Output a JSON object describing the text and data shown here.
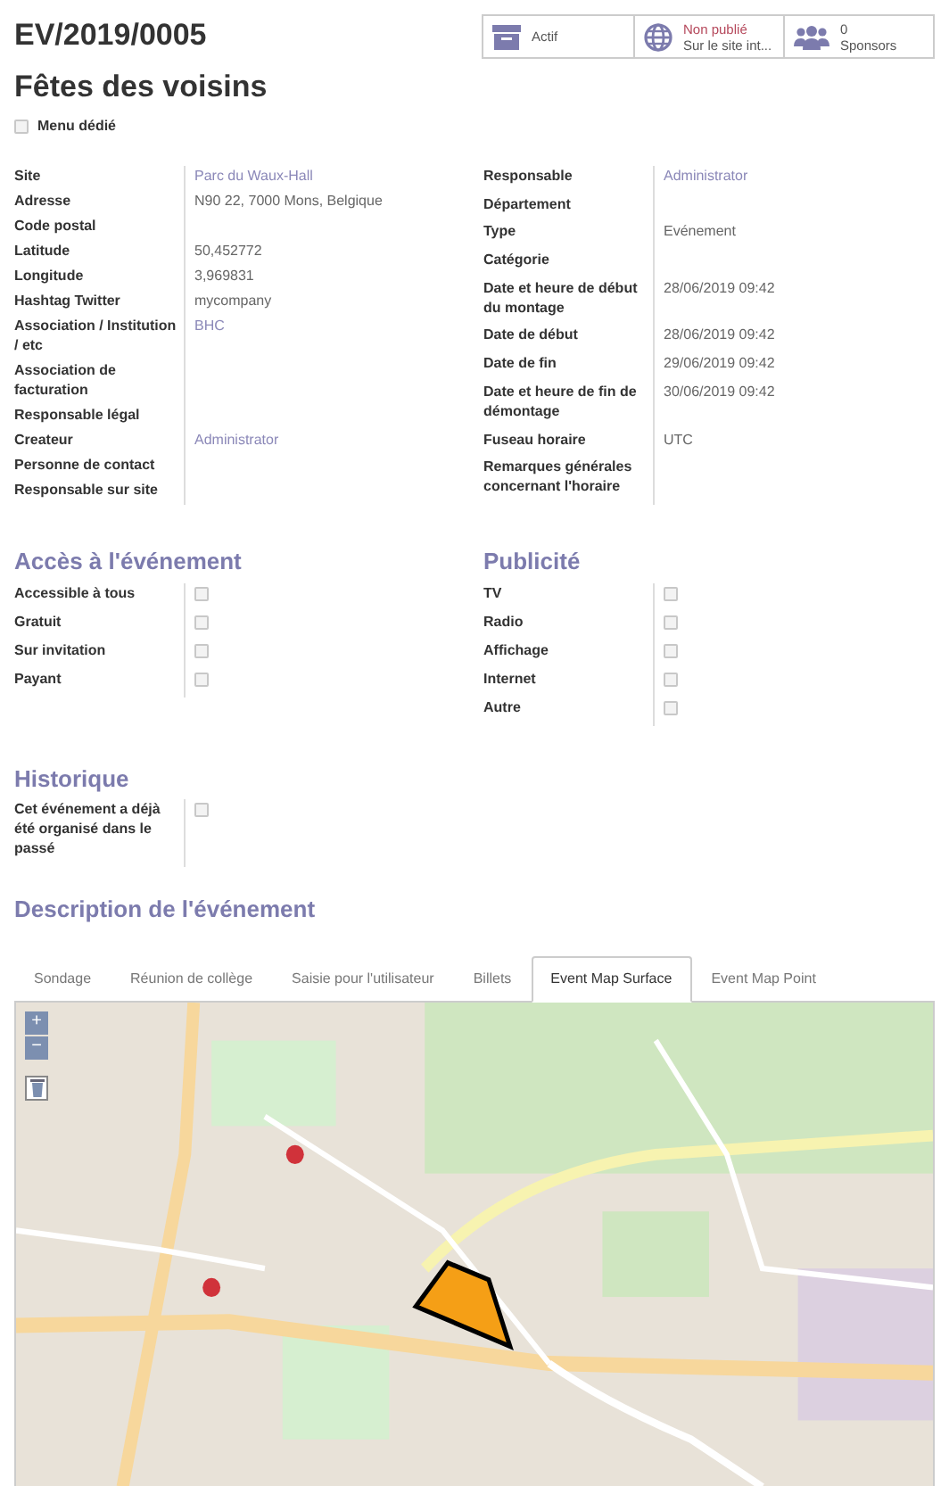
{
  "record": {
    "reference": "EV/2019/0005",
    "name": "Fêtes des voisins",
    "dedicated_menu": {
      "label": "Menu dédié",
      "checked": false
    }
  },
  "smart_buttons": [
    {
      "kind": "archive",
      "lines": [
        "Actif"
      ]
    },
    {
      "kind": "website",
      "lines": [
        "Non publié",
        "Sur le site int..."
      ]
    },
    {
      "kind": "sponsors",
      "lines": [
        "0",
        "Sponsors"
      ]
    }
  ],
  "fields_left": [
    {
      "label": "Site",
      "value": "Parc du Waux-Hall",
      "kind": "link"
    },
    {
      "label": "Adresse",
      "value": "N90 22, 7000 Mons, Belgique",
      "kind": "text"
    },
    {
      "label": "Code postal"
    },
    {
      "label": "Latitude",
      "value": "50,452772",
      "kind": "text"
    },
    {
      "label": "Longitude",
      "value": "3,969831",
      "kind": "text"
    },
    {
      "label": "Hashtag Twitter",
      "value": "mycompany",
      "kind": "text"
    },
    {
      "label": "Association / Institution / etc",
      "value": "BHC",
      "kind": "link"
    },
    {
      "label": "Association de facturation"
    },
    {
      "label": "Responsable légal"
    },
    {
      "label": "Createur",
      "value": "Administrator",
      "kind": "link"
    },
    {
      "label": "Personne de contact"
    },
    {
      "label": "Responsable sur site"
    }
  ],
  "fields_right": [
    {
      "label": "Responsable",
      "value": "Administrator",
      "kind": "link"
    },
    {
      "label": "Département"
    },
    {
      "label": "Type",
      "value": "Evénement",
      "kind": "text"
    },
    {
      "label": "Catégorie"
    },
    {
      "label": "Date et heure de début du montage",
      "value": "28/06/2019 09:42",
      "kind": "text"
    },
    {
      "label": "Date de début",
      "value": "28/06/2019 09:42",
      "kind": "text"
    },
    {
      "label": "Date de fin",
      "value": "29/06/2019 09:42",
      "kind": "text"
    },
    {
      "label": "Date et heure de fin de démontage",
      "value": "30/06/2019 09:42",
      "kind": "text"
    },
    {
      "label": "Fuseau horaire",
      "value": "UTC",
      "kind": "text"
    },
    {
      "label": "Remarques générales concernant l'horaire"
    }
  ],
  "access": {
    "title": "Accès à l'événement",
    "items": [
      {
        "label": "Accessible à tous",
        "checked": false
      },
      {
        "label": "Gratuit",
        "checked": false
      },
      {
        "label": "Sur invitation",
        "checked": false
      },
      {
        "label": "Payant",
        "checked": false
      }
    ]
  },
  "publicity": {
    "title": "Publicité",
    "items": [
      {
        "label": "TV",
        "checked": false
      },
      {
        "label": "Radio",
        "checked": false
      },
      {
        "label": "Affichage",
        "checked": false
      },
      {
        "label": "Internet",
        "checked": false
      },
      {
        "label": "Autre",
        "checked": false
      }
    ]
  },
  "history": {
    "title": "Historique",
    "items": [
      {
        "label": "Cet événement a déjà été organisé dans le passé",
        "checked": false
      }
    ]
  },
  "description": {
    "title": "Description de l'événement"
  },
  "tabs": [
    {
      "label": "Sondage",
      "selected": false
    },
    {
      "label": "Réunion de collège",
      "selected": false
    },
    {
      "label": "Saisie pour l'utilisateur",
      "selected": false
    },
    {
      "label": "Billets",
      "selected": false
    },
    {
      "label": "Event Map Surface",
      "selected": true
    },
    {
      "label": "Event Map Point",
      "selected": false
    }
  ],
  "map": {
    "zoom_in": "+",
    "zoom_out": "−"
  }
}
